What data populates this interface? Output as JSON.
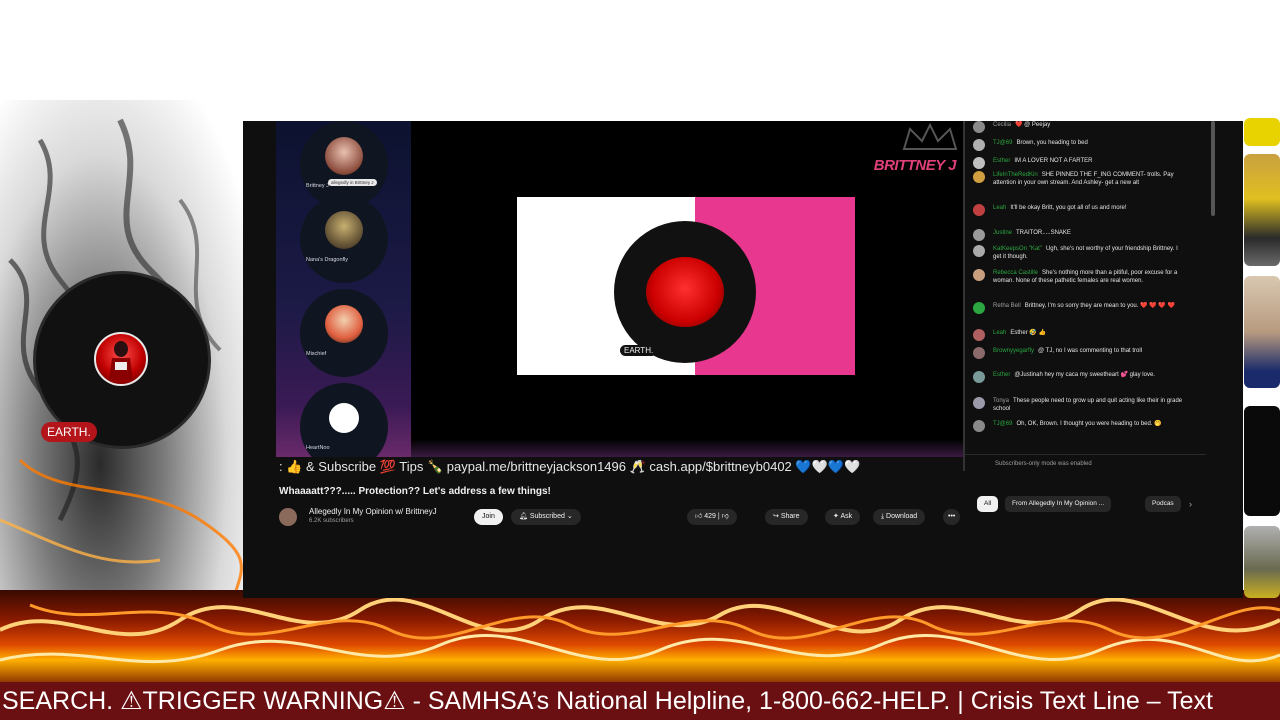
{
  "overlay": {
    "ticker_text": "SEARCH. ⚠TRIGGER WARNING⚠ - SAMHSA’s National Helpline, 1-800-662-HELP. | Crisis Text Line – Text",
    "streamer_tag": "EARTH."
  },
  "stream": {
    "brand": "BRITTNEY J",
    "art_tag": "EARTH.",
    "guests": [
      {
        "name": "Brittney J",
        "sub": "allegedly in Brittney J"
      },
      {
        "name": "Nana's Dragonfly"
      },
      {
        "name": "Mischief"
      },
      {
        "name": "HeartNoo"
      }
    ]
  },
  "chat": {
    "messages": [
      {
        "author": "Cecilia",
        "text": "❤️ @ Peejay",
        "member": false
      },
      {
        "author": "TJ@69",
        "text": "Brown, you heading to bed",
        "member": true
      },
      {
        "author": "Esther",
        "text": "IM A LOVER NOT A FARTER",
        "member": true
      },
      {
        "author": "LifeInTheRedKin",
        "text": "SHE PINNED THE F_ING COMMENT- trolls. Pay attention in your own stream. And Ashley- get a new alt",
        "member": true
      },
      {
        "author": "Leah",
        "text": "It'll be okay Britt, you got all of us and more!",
        "member": true
      },
      {
        "author": "Justine",
        "text": "TRAITOR.....SNAKE",
        "member": true
      },
      {
        "author": "KatKeepsOn \"Kat\"",
        "text": "Ugh, she's not worthy of your friendship Brittney. I get it though.",
        "member": true
      },
      {
        "author": "Rebecca Castille",
        "text": "She's nothing more than a pitiful, poor excuse for a woman. None of these pathetic females are real women.",
        "member": true
      },
      {
        "author": "Retha Bell",
        "text": "Brittney, I'm so sorry they are mean to you. ❤️ ❤️ ❤️ ❤️",
        "member": false
      },
      {
        "author": "Leah",
        "text": "Esther 🤣 👍",
        "member": true
      },
      {
        "author": "Brownyyegarfly",
        "text": "@ TJ, no I was commenting to that troll",
        "member": true
      },
      {
        "author": "Esther",
        "text": "@Justinah hey my caca my sweetheart 💕 glay love.",
        "member": true
      },
      {
        "author": "Tonya",
        "text": "These people need to grow up and quit acting like their in grade school",
        "member": false
      },
      {
        "author": "TJ@69",
        "text": "Oh, OK, Brown. I thought you were heading to bed. 🤭",
        "member": true
      }
    ],
    "footer": "Subscribers-only mode was enabled"
  },
  "video": {
    "promo_ticker": ": 👍 & Subscribe 💯 Tips 🍾 paypal.me/brittneyjackson1496 🥂 cash.app/$brittneyb0402 💙🤍💙🤍",
    "title": "Whaaaatt???..... Protection?? Let's address a few things!",
    "channel_name": "Allegedly In My Opinion w/ BrittneyJ",
    "subscribers": "6.2K subscribers",
    "join_label": "Join",
    "subscribed_label": "Subscribed",
    "like_count": "429",
    "share_label": "Share",
    "ask_label": "Ask",
    "download_label": "Download",
    "more_label": "•••"
  },
  "chips": [
    "All",
    "From Allegedly In My Opinion ...",
    "Podcas"
  ],
  "colors": {
    "ticker_bg": "#6a0f12",
    "name_tag": "#b3151b",
    "brand_pink": "#e0407a",
    "member_green": "#2ba640"
  }
}
